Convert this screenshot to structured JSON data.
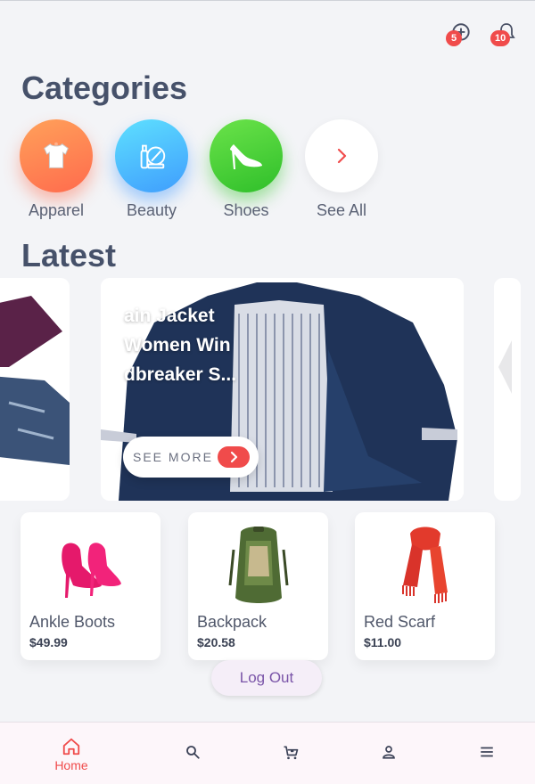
{
  "header": {
    "messages_badge": "5",
    "notifications_badge": "10"
  },
  "categories": {
    "title": "Categories",
    "items": [
      {
        "label": "Apparel",
        "icon": "tshirt-icon"
      },
      {
        "label": "Beauty",
        "icon": "cosmetics-icon"
      },
      {
        "label": "Shoes",
        "icon": "high-heel-icon"
      },
      {
        "label": "See All",
        "icon": "chevron-right-icon"
      }
    ]
  },
  "latest": {
    "title": "Latest",
    "featured": {
      "title": "ain Jacket Women Win dbreaker S...",
      "button_label": "SEE MORE"
    }
  },
  "products": [
    {
      "name": "Ankle Boots",
      "price": "$49.99"
    },
    {
      "name": "Backpack",
      "price": "$20.58"
    },
    {
      "name": "Red Scarf",
      "price": "$11.00"
    }
  ],
  "logout_label": "Log Out",
  "bottom_nav": {
    "items": [
      {
        "label": "Home",
        "icon": "home-icon",
        "active": true
      },
      {
        "label": "",
        "icon": "search-icon"
      },
      {
        "label": "",
        "icon": "cart-icon"
      },
      {
        "label": "",
        "icon": "person-icon"
      },
      {
        "label": "",
        "icon": "menu-icon"
      }
    ]
  },
  "colors": {
    "accent": "#f04b4b",
    "background": "#f3f4f7",
    "logout_text": "#7a54a8"
  }
}
